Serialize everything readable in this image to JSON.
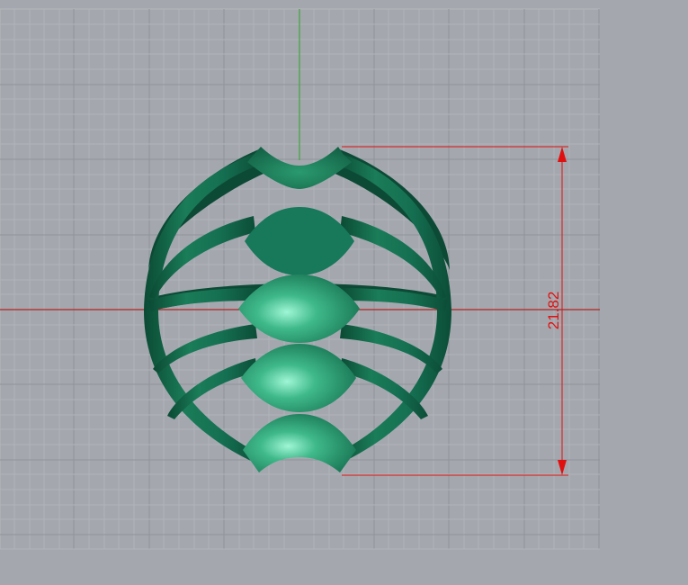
{
  "viewport": {
    "background": "#a4a8ae",
    "grid_color_minor": "#b3b7bc",
    "grid_color_major": "#8f949a",
    "axis_y_color": "#3fa43f",
    "axis_x_color": "#b22222"
  },
  "model": {
    "color_dark": "#0f5a40",
    "color_mid": "#1c8a64",
    "color_light": "#8ff2cc"
  },
  "dimension": {
    "value": "21.82",
    "color": "#e01010"
  }
}
